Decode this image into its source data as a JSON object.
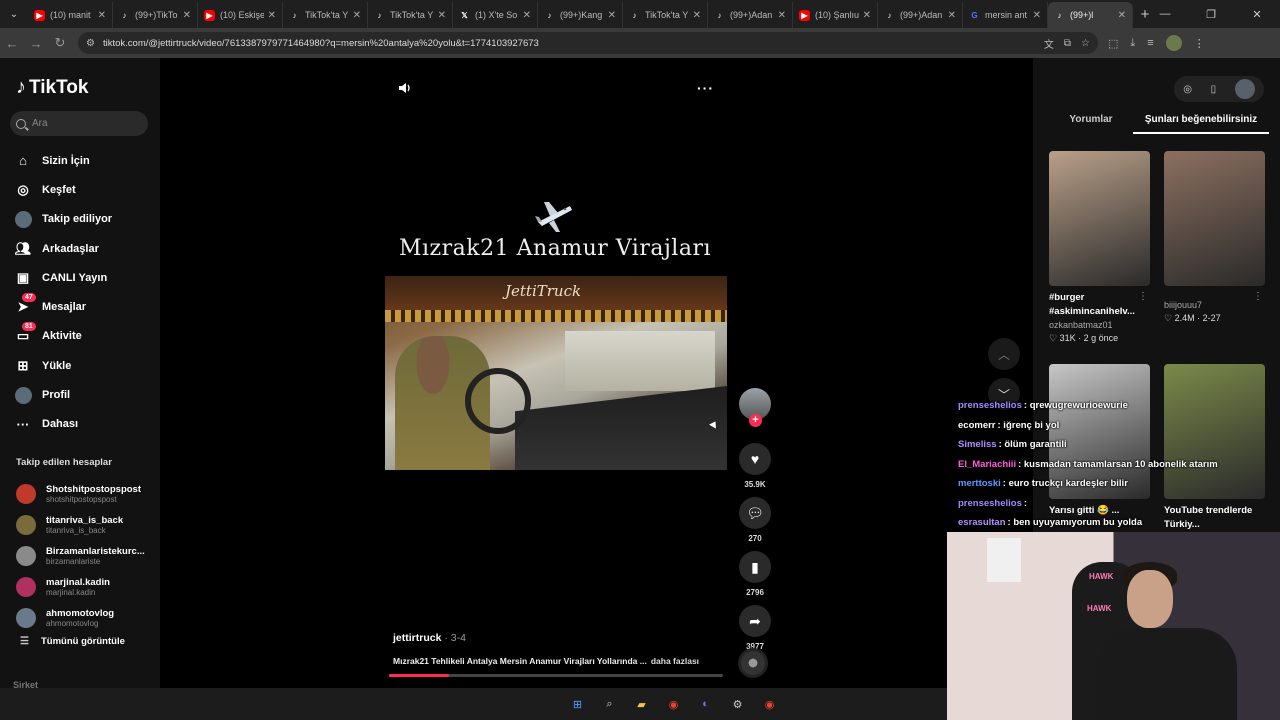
{
  "browser": {
    "tabs": [
      {
        "title": "(10) manit",
        "favicon": "youtube",
        "color": "#ff0000"
      },
      {
        "title": "(99+)TikTo",
        "favicon": "tiktok",
        "color": "#000000"
      },
      {
        "title": "(10) Eskişe",
        "favicon": "youtube",
        "color": "#ff0000"
      },
      {
        "title": "TikTok'ta Y",
        "favicon": "tiktok",
        "color": "#000000"
      },
      {
        "title": "TikTok'ta Y",
        "favicon": "tiktok",
        "color": "#000000"
      },
      {
        "title": "(1) X'te So",
        "favicon": "x",
        "color": "#000000"
      },
      {
        "title": "(99+)Kang",
        "favicon": "tiktok",
        "color": "#000000"
      },
      {
        "title": "TikTok'ta Y",
        "favicon": "tiktok",
        "color": "#000000"
      },
      {
        "title": "(99+)Adan",
        "favicon": "tiktok",
        "color": "#000000"
      },
      {
        "title": "(10) Şanlıu",
        "favicon": "youtube",
        "color": "#ff0000"
      },
      {
        "title": "(99+)Adan",
        "favicon": "tiktok",
        "color": "#000000"
      },
      {
        "title": "mersin ant",
        "favicon": "google",
        "color": "#4285f4"
      },
      {
        "title": "(99+)l",
        "favicon": "tiktok",
        "color": "#000000",
        "active": true
      }
    ],
    "url": "tiktok.com/@jettirtruck/video/7613387979771464980?q=mersin%20antalya%20yolu&t=1774103927673"
  },
  "sidebar": {
    "logo": "TikTok",
    "search_placeholder": "Ara",
    "nav": [
      {
        "label": "Sizin İçin",
        "icon": "home-icon"
      },
      {
        "label": "Keşfet",
        "icon": "compass-icon"
      },
      {
        "label": "Takip ediliyor",
        "icon": "following-avatar-icon"
      },
      {
        "label": "Arkadaşlar",
        "icon": "friends-icon"
      },
      {
        "label": "CANLI Yayın",
        "icon": "live-icon"
      },
      {
        "label": "Mesajlar",
        "icon": "messages-icon",
        "badge": "47"
      },
      {
        "label": "Aktivite",
        "icon": "activity-icon",
        "badge": "81"
      },
      {
        "label": "Yükle",
        "icon": "upload-icon"
      },
      {
        "label": "Profil",
        "icon": "profile-avatar-icon"
      },
      {
        "label": "Dahası",
        "icon": "more-icon"
      }
    ],
    "following_header": "Takip edilen hesaplar",
    "following": [
      {
        "name": "Shotshitpostopspost",
        "handle": "shotshitpostopspost",
        "color": "#c0392b"
      },
      {
        "name": "titanriva_is_back",
        "handle": "titanriva_is_back",
        "color": "#7a6b3a"
      },
      {
        "name": "Birzamanlaristekurc...",
        "handle": "birzamanlariste",
        "color": "#8a8a8a"
      },
      {
        "name": "marjinal.kadin",
        "handle": "marjinal.kadin",
        "color": "#b03060"
      },
      {
        "name": "ahmomotovlog",
        "handle": "ahmomotovlog",
        "color": "#6a7a8a"
      }
    ],
    "see_all": "Tümünü görüntüle",
    "company": "Şirket"
  },
  "video": {
    "overlay_title": "Mızrak21 Anamur Virajları",
    "frame_brand": "JettiTruck",
    "author": "jettirtruck",
    "date": " · 3-4",
    "caption": "Mızrak21 Tehlikeli Antalya Mersin Anamur Virajları Yollarında ...",
    "caption_more": "daha fazlası",
    "likes": "35.9K",
    "comments": "270",
    "saves": "2796",
    "shares": "3977",
    "progress_fraction": 0.18
  },
  "right_panel": {
    "tab_comments": "Yorumlar",
    "tab_suggested": "Şunları beğenebilirsiniz",
    "cards": [
      {
        "title": "#burger #askimincanihelv...",
        "author": "ozkanbatmaz01",
        "stats": "♡ 31K · 2 g önce",
        "thumb": "#b9a089"
      },
      {
        "title": "",
        "author": "",
        "stats": "♡ 2.4M · 2-27",
        "author_alt": "biiijouuu7",
        "thumb": "#8c7060"
      },
      {
        "title": "Yarısı gitti 😂 ...",
        "author": "",
        "stats": "",
        "thumb": "#c7c7c7"
      },
      {
        "title": "YouTube trendlerde Türkiy...",
        "author": "",
        "stats": "",
        "thumb": "#7b8a4a"
      }
    ]
  },
  "chat": [
    {
      "user": "prenseshelios",
      "msg": ": qrewugrewurioewurie",
      "color": "#9b8cff"
    },
    {
      "user": "ecomerr",
      "msg": ": iğrenç bi yol",
      "color": "#ffffff"
    },
    {
      "user": "Simeliss",
      "msg": ": ölüm garantili",
      "color": "#b18cff"
    },
    {
      "user": "El_Mariachiii",
      "msg": ": kusmadan tamamlarsan 10 abonelik atarım",
      "color": "#ff5cdc"
    },
    {
      "user": "merttoski",
      "msg": ": euro truckçı kardeşler bilir",
      "color": "#5b9bff"
    },
    {
      "user": "prenseshelios",
      "msg": ":",
      "color": "#9b8cff"
    },
    {
      "user": "esrasultan",
      "msg": ": ben uyuyamıyorum bu yolda",
      "color": "#b18cff"
    }
  ],
  "webcam": {
    "brand_text": "HAWK"
  }
}
